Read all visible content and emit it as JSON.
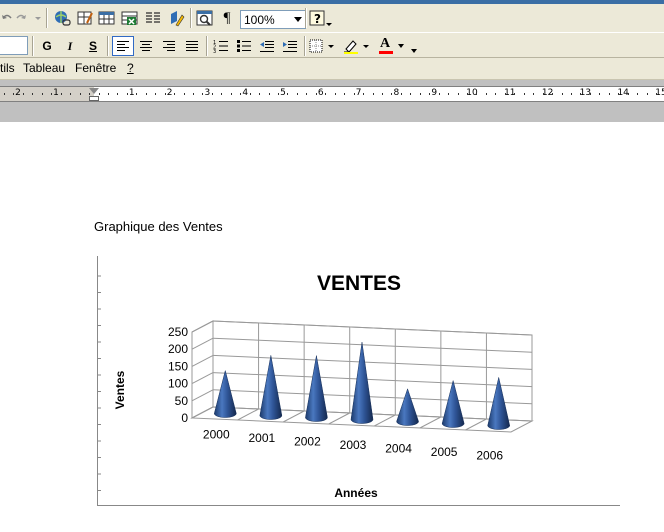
{
  "toolbar_standard": {
    "zoom_value": "100%",
    "icons": [
      "undo-icon",
      "redo-icon",
      "insert-hyperlink-icon",
      "tables-borders-icon",
      "insert-table-icon",
      "insert-excel-icon",
      "columns-icon",
      "drawing-icon",
      "document-map-icon",
      "show-formatting-icon",
      "help-icon"
    ]
  },
  "toolbar_formatting": {
    "bold_label": "G",
    "italic_label": "I",
    "underline_label": "S",
    "font_color_label": "A",
    "colors": {
      "highlight": "#ffff00",
      "font_color": "#ff0000",
      "selection": "#316ac5"
    }
  },
  "menu": {
    "items": [
      "tils",
      "Tableau",
      "Fenêtre",
      "?"
    ]
  },
  "ruler": {
    "left_labels": [
      "2",
      "1"
    ],
    "labels": [
      "1",
      "2",
      "3",
      "4",
      "5",
      "6",
      "7",
      "8",
      "9",
      "10",
      "11",
      "12",
      "13",
      "14",
      "15"
    ]
  },
  "document": {
    "caption": "Graphique des Ventes"
  },
  "chart_data": {
    "type": "bar",
    "style": "3d-cone",
    "title": "VENTES",
    "xlabel": "Années",
    "ylabel": "Ventes",
    "categories": [
      "2000",
      "2001",
      "2002",
      "2003",
      "2004",
      "2005",
      "2006"
    ],
    "values": [
      125,
      175,
      180,
      225,
      95,
      125,
      140
    ],
    "ylim": [
      0,
      250
    ],
    "yticks": [
      "0",
      "50",
      "100",
      "150",
      "200",
      "250"
    ],
    "grid": true,
    "legend": "none",
    "color": "#2f5597"
  }
}
